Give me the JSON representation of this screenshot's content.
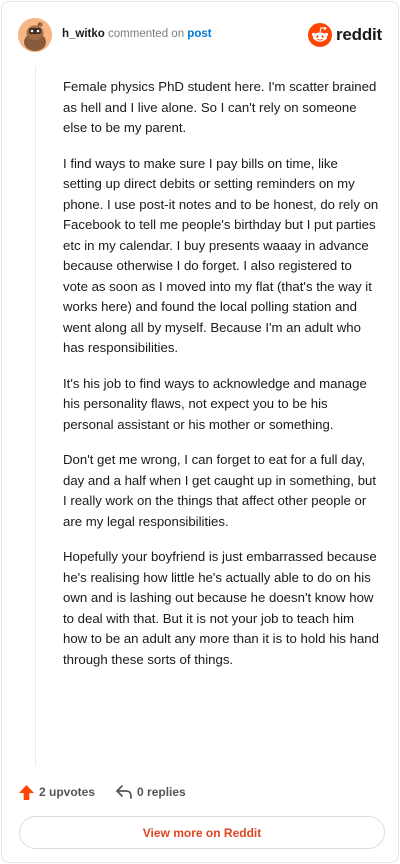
{
  "comment": {
    "username": "h_witko",
    "action_text": "commented on",
    "link_text": "post",
    "paragraphs": [
      "Female physics PhD student here. I'm scatter brained as hell and I live alone. So I can't rely on someone else to be my parent.",
      "I find ways to make sure I pay bills on time, like setting up direct debits or setting reminders on my phone. I use post-it notes and to be honest, do rely on Facebook to tell me people's birthday but I put parties etc in my calendar. I buy presents waaay in advance because otherwise I do forget. I also registered to vote as soon as I moved into my flat (that's the way it works here) and found the local polling station and went along all by myself. Because I'm an adult who has responsibilities.",
      "It's his job to find ways to acknowledge and manage his personality flaws, not expect you to be his personal assistant or his mother or something.",
      "Don't get me wrong, I can forget to eat for a full day, day and a half when I get caught up in something, but I really work on the things that affect other people or are my legal responsibilities.",
      "Hopefully your boyfriend is just embarrassed because he's realising how little he's actually able to do on his own and is lashing out because he doesn't know how to deal with that. But it is not your job to teach him how to be an adult any more than it is to hold his hand through these sorts of things."
    ],
    "upvotes_label": "2 upvotes",
    "replies_label": "0 replies"
  },
  "brand": {
    "name": "reddit",
    "icon": "reddit-logo-icon",
    "color": "#ff4500"
  },
  "footer": {
    "view_more_label": "View more on Reddit"
  },
  "colors": {
    "upvote": "#ff4500",
    "link": "#0079d3",
    "cta": "#e0461f"
  }
}
